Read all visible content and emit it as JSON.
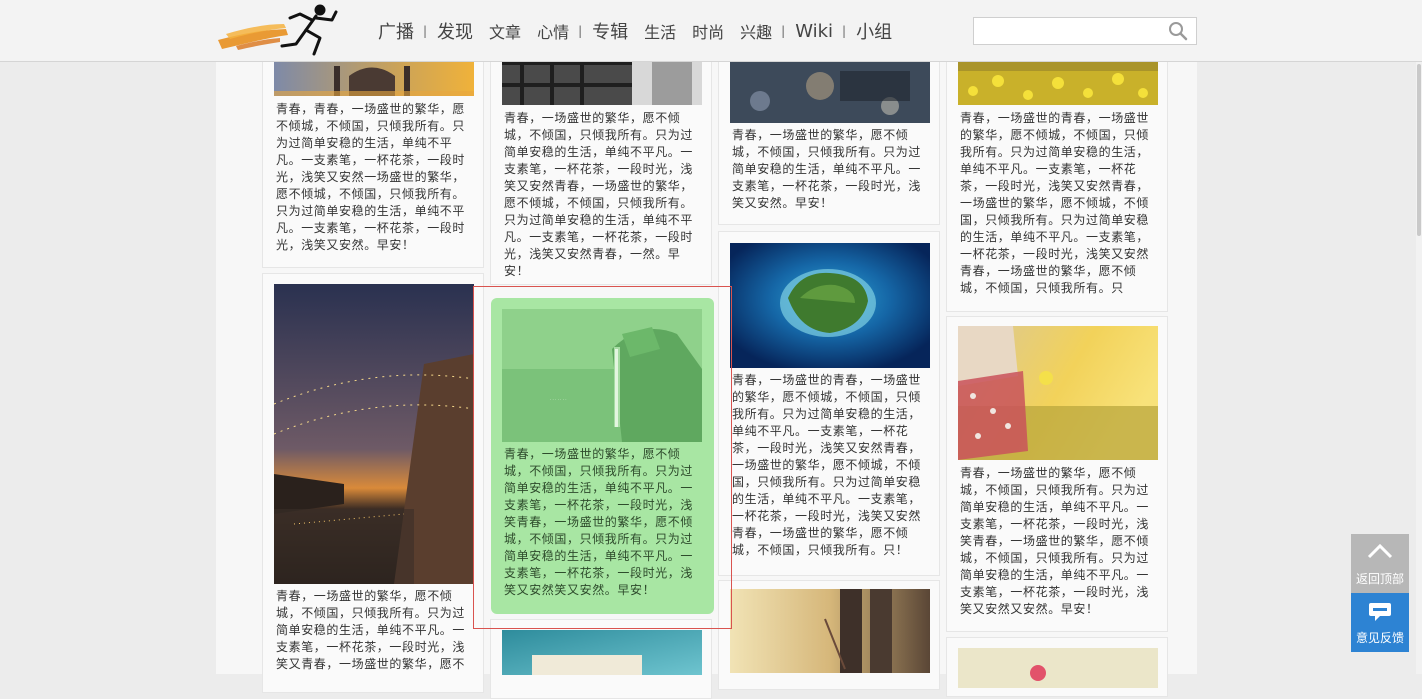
{
  "header": {
    "nav": [
      {
        "label": "广播",
        "size": "big",
        "sep": true
      },
      {
        "label": "发现",
        "size": "big",
        "sep": false
      },
      {
        "label": "文章",
        "size": "small",
        "sep": false
      },
      {
        "label": "心情",
        "size": "small",
        "sep": true
      },
      {
        "label": "专辑",
        "size": "big",
        "sep": false
      },
      {
        "label": "生活",
        "size": "small",
        "sep": false
      },
      {
        "label": "时尚",
        "size": "small",
        "sep": false
      },
      {
        "label": "兴趣",
        "size": "small",
        "sep": true
      },
      {
        "label": "Wiki",
        "size": "big",
        "sep": true
      },
      {
        "label": "小组",
        "size": "big",
        "sep": false
      }
    ],
    "separator": "|",
    "search": {
      "value": "",
      "placeholder": ""
    }
  },
  "cards": [
    {
      "text": "青春，青春，一场盛世的繁华，愿不倾城，不倾国，只倾我所有。只为过简单安稳的生活，单纯不平凡。一支素笔，一杯花茶，一段时光，浅笑又安然一场盛世的繁华，愿不倾城，不倾国，只倾我所有。只为过简单安稳的生活，单纯不平凡。一支素笔，一杯花茶，一段时光，浅笑又安然。早安！"
    },
    {
      "text": "青春，一场盛世的繁华，愿不倾城，不倾国，只倾我所有。只为过简单安稳的生活，单纯不平凡。一支素笔，一杯花茶，一段时光，浅笑又安然青春，一场盛世的繁华，愿不倾城，不倾国，只倾我所有。只为过简单安稳的生活，单纯不平凡。一支素笔，一杯花茶，一段时光，浅笑又安然青春，一然。早安！"
    },
    {
      "text": "青春，一场盛世的繁华，愿不倾城，不倾国，只倾我所有。只为过简单安稳的生活，单纯不平凡。一支素笔，一杯花茶，一段时光，浅笑又安然。早安！"
    },
    {
      "text": "青春，一场盛世的青春，一场盛世的繁华，愿不倾城，不倾国，只倾我所有。只为过简单安稳的生活，单纯不平凡。一支素笔，一杯花茶，一段时光，浅笑又安然青春，一场盛世的繁华，愿不倾城，不倾国，只倾我所有。只为过简单安稳的生活，单纯不平凡。一支素笔，一杯花茶，一段时光，浅笑又安然青春，一场盛世的繁华，愿不倾城，不倾国，只倾我所有。只"
    },
    {
      "text": "青春，一场盛世的繁华，愿不倾城，不倾国，只倾我所有。只为过简单安稳的生活，单纯不平凡。一支素笔，一杯花茶，一段时光，浅笑又青春，一场盛世的繁华，愿不"
    },
    {
      "text": "青春，一场盛世的繁华，愿不倾城，不倾国，只倾我所有。只为过简单安稳的生活，单纯不平凡。一支素笔，一杯花茶，一段时光，浅笑青春，一场盛世的繁华，愿不倾城，不倾国，只倾我所有。只为过简单安稳的生活，单纯不平凡。一支素笔，一杯花茶，一段时光，浅笑又安然笑又安然。早安！"
    },
    {
      "text": "青春，一场盛世的青春，一场盛世的繁华，愿不倾城，不倾国，只倾我所有。只为过简单安稳的生活，单纯不平凡。一支素笔，一杯花茶，一段时光，浅笑又安然青春，一场盛世的繁华，愿不倾城，不倾国，只倾我所有。只为过简单安稳的生活，单纯不平凡。一支素笔，一杯花茶，一段时光，浅笑又安然青春，一场盛世的繁华，愿不倾城，不倾国，只倾我所有。只！"
    },
    {
      "text": "青春，一场盛世的繁华，愿不倾城，不倾国，只倾我所有。只为过简单安稳的生活，单纯不平凡。一支素笔，一杯花茶，一段时光，浅笑青春，一场盛世的繁华，愿不倾城，不倾国，只倾我所有。只为过简单安稳的生活，单纯不平凡。一支素笔，一杯花茶，一段时光，浅笑又安然又安然。早安！"
    }
  ],
  "side": {
    "top_label": "返回顶部",
    "feedback_label": "意见反馈"
  },
  "colors": {
    "highlight_bg": "#a8e6a3",
    "highlight_border": "#d9534f",
    "feedback_bg": "#2d83d3"
  }
}
